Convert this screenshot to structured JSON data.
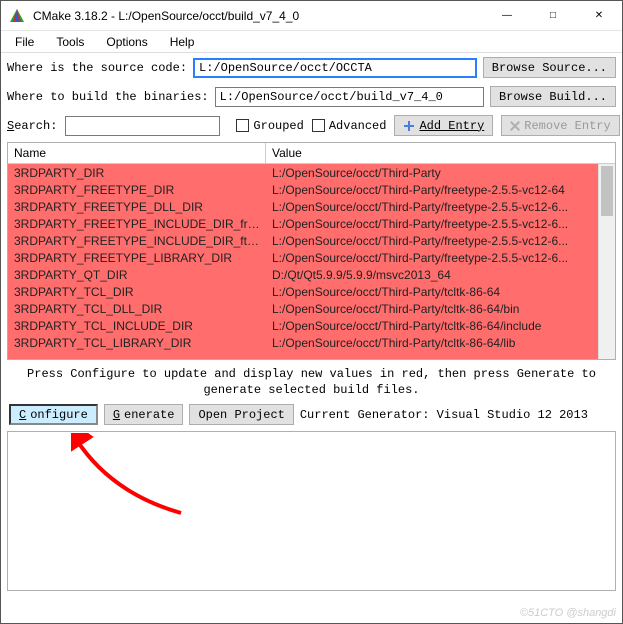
{
  "window": {
    "title": "CMake 3.18.2 - L:/OpenSource/occt/build_v7_4_0",
    "minimize": "—",
    "maximize": "□",
    "close": "✕"
  },
  "menu": {
    "file": "File",
    "tools": "Tools",
    "options": "Options",
    "help": "Help"
  },
  "form": {
    "source_label": "Where is the source code:",
    "source_value": "L:/OpenSource/occt/OCCTA",
    "browse_source": "Browse Source...",
    "build_label": "Where to build the binaries:",
    "build_value": "L:/OpenSource/occt/build_v7_4_0",
    "browse_build": "Browse Build..."
  },
  "toolbar": {
    "search_label": "Search:",
    "grouped": "Grouped",
    "advanced": "Advanced",
    "add_entry": "Add Entry",
    "remove_entry": "Remove Entry"
  },
  "cache": {
    "header_name": "Name",
    "header_value": "Value",
    "rows": [
      {
        "name": "3RDPARTY_DIR",
        "value": "L:/OpenSource/occt/Third-Party"
      },
      {
        "name": "3RDPARTY_FREETYPE_DIR",
        "value": "L:/OpenSource/occt/Third-Party/freetype-2.5.5-vc12-64"
      },
      {
        "name": "3RDPARTY_FREETYPE_DLL_DIR",
        "value": "L:/OpenSource/occt/Third-Party/freetype-2.5.5-vc12-6..."
      },
      {
        "name": "3RDPARTY_FREETYPE_INCLUDE_DIR_fre...",
        "value": "L:/OpenSource/occt/Third-Party/freetype-2.5.5-vc12-6..."
      },
      {
        "name": "3RDPARTY_FREETYPE_INCLUDE_DIR_ft2...",
        "value": "L:/OpenSource/occt/Third-Party/freetype-2.5.5-vc12-6..."
      },
      {
        "name": "3RDPARTY_FREETYPE_LIBRARY_DIR",
        "value": "L:/OpenSource/occt/Third-Party/freetype-2.5.5-vc12-6..."
      },
      {
        "name": "3RDPARTY_QT_DIR",
        "value": "D:/Qt/Qt5.9.9/5.9.9/msvc2013_64"
      },
      {
        "name": "3RDPARTY_TCL_DIR",
        "value": "L:/OpenSource/occt/Third-Party/tcltk-86-64"
      },
      {
        "name": "3RDPARTY_TCL_DLL_DIR",
        "value": "L:/OpenSource/occt/Third-Party/tcltk-86-64/bin"
      },
      {
        "name": "3RDPARTY_TCL_INCLUDE_DIR",
        "value": "L:/OpenSource/occt/Third-Party/tcltk-86-64/include"
      },
      {
        "name": "3RDPARTY_TCL_LIBRARY_DIR",
        "value": "L:/OpenSource/occt/Third-Party/tcltk-86-64/lib"
      }
    ]
  },
  "hint": "Press Configure to update and display new values in red, then press Generate to generate selected build files.",
  "actions": {
    "configure": "Configure",
    "generate": "Generate",
    "open_project": "Open Project",
    "current_gen": "Current Generator: Visual Studio 12 2013"
  },
  "watermark": "©51CTO @shangdi"
}
